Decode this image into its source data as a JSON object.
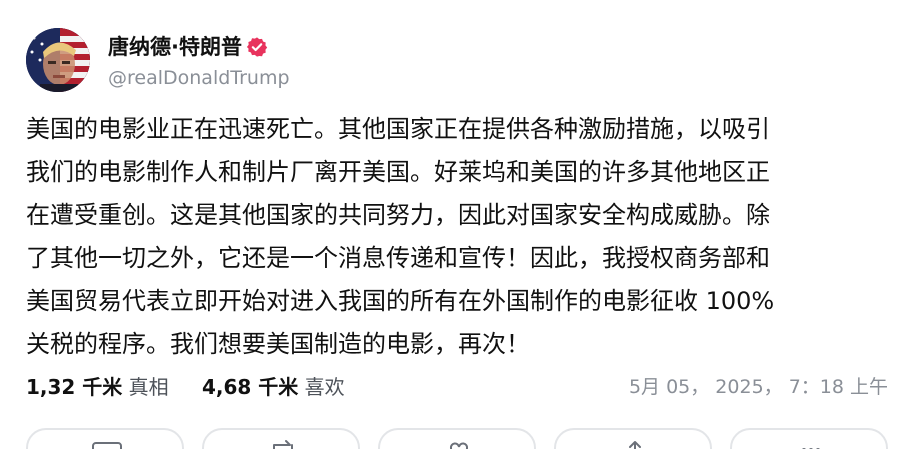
{
  "post": {
    "author": {
      "display_name": "唐纳德·特朗普",
      "handle": "@realDonaldTrump",
      "verified": true,
      "avatar_icon": "avatar-portrait-flag",
      "verified_color": "#e8335d"
    },
    "body_lines": [
      "美国的电影业正在迅速死亡。其他国家正在提供各种激励措施，以吸引",
      "我们的电影制作人和制片厂离开美国。好莱坞和美国的许多其他地区正",
      "在遭受重创。这是其他国家的共同努力，因此对国家安全构成威胁。除",
      "了其他一切之外，它还是一个消息传递和宣传！因此，我授权商务部和",
      "美国贸易代表立即开始对进入我国的所有在外国制作的电影征收 100%",
      "关税的程序。我们想要美国制造的电影，再次！"
    ],
    "stats": {
      "retruths_value": "1,32 千米",
      "retruths_label": "真相",
      "likes_value": "4,68 千米",
      "likes_label": "喜欢"
    },
    "timestamp": "5月 05， 2025， 7：18 上午"
  },
  "actions": [
    "reply-icon",
    "retruth-icon",
    "like-icon",
    "share-icon",
    "more-icon"
  ]
}
